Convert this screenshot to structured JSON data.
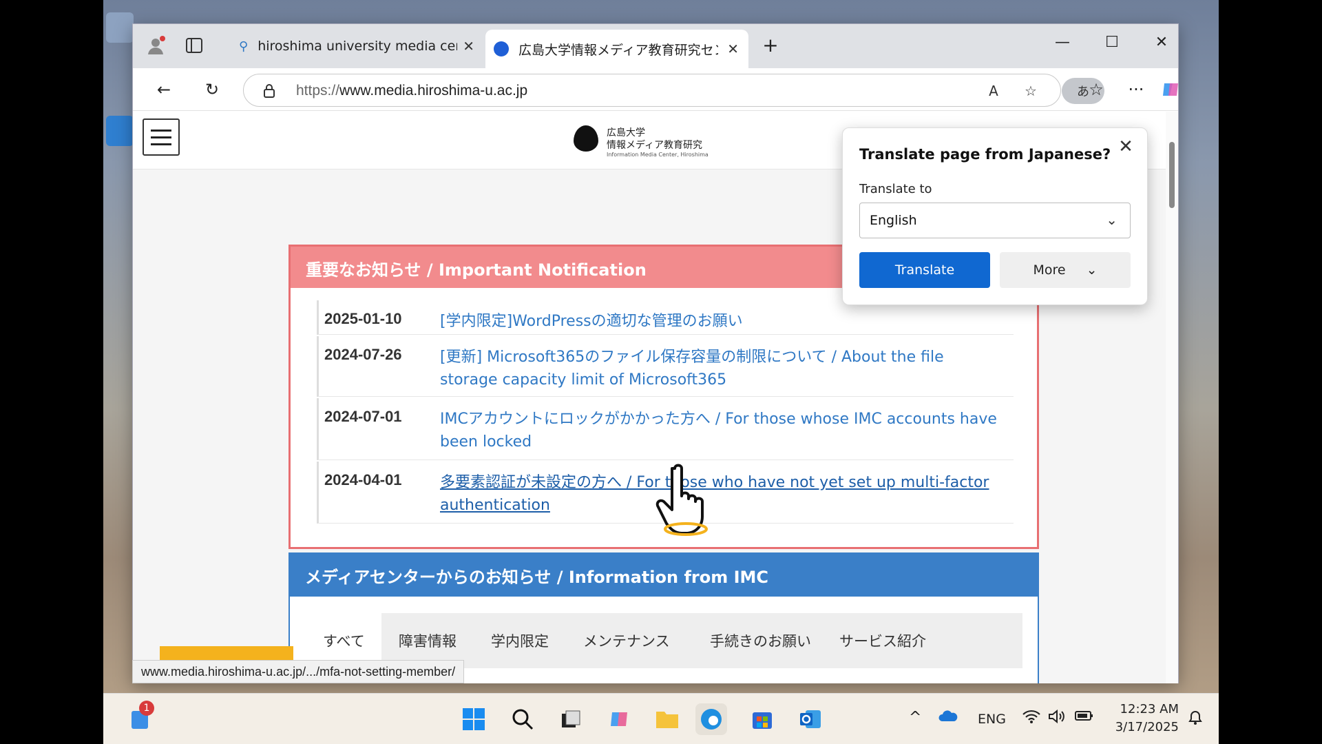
{
  "browser": {
    "tabs": [
      {
        "title": "hiroshima university media center",
        "icon": "search-icon"
      },
      {
        "title": "広島大学情報メディア教育研究センター",
        "icon": "hiroshima-university-favicon"
      }
    ],
    "address": {
      "scheme": "https://",
      "host": "www.media.hiroshima-u.ac.jp"
    },
    "translate_button_label": "あ",
    "status_url": "www.media.hiroshima-u.ac.jp/.../mfa-not-setting-member/"
  },
  "site": {
    "logo_line1": "広島大学",
    "logo_line2": "情報メディア教育研究",
    "logo_line3": "Information Media Center, Hiroshima"
  },
  "important": {
    "title": "重要なお知らせ / Important Notification",
    "items": [
      {
        "date": "2025-01-10",
        "text": "[学内限定]WordPressの適切な管理のお願い"
      },
      {
        "date": "2024-07-26",
        "text": "[更新] Microsoft365のファイル保存容量の制限について / About the file storage capacity limit of Microsoft365"
      },
      {
        "date": "2024-07-01",
        "text": "IMCアカウントにロックがかかった方へ / For those whose IMC accounts have been locked"
      },
      {
        "date": "2024-04-01",
        "text": "多要素認証が未設定の方へ / For those who have not yet set up multi-factor authentication"
      }
    ]
  },
  "info": {
    "title": "メディアセンターからのお知らせ / Information from IMC",
    "tabs": [
      "すべて",
      "障害情報",
      "学内限定",
      "メンテナンス",
      "手続きのお願い",
      "サービス紹介"
    ]
  },
  "translate_popup": {
    "title": "Translate page from Japanese?",
    "label": "Translate to",
    "selected_language": "English",
    "translate_button": "Translate",
    "more_button": "More"
  },
  "taskbar": {
    "notification_count": "1",
    "language": "ENG",
    "time": "12:23 AM",
    "date": "3/17/2025"
  },
  "colors": {
    "important_header": "#f28b8d",
    "info_header": "#3a7fc8",
    "link": "#2f78c4",
    "translate_button": "#1068d1"
  }
}
